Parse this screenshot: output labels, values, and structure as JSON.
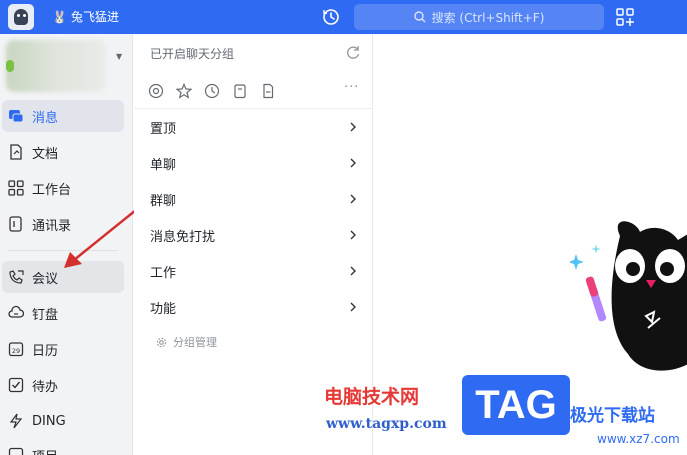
{
  "topbar": {
    "org_name": "兔飞猛进",
    "search_placeholder": "搜索 (Ctrl+Shift+F)"
  },
  "sidebar": {
    "items": [
      {
        "label": "消息",
        "icon": "message-icon",
        "active": true
      },
      {
        "label": "文档",
        "icon": "doc-icon"
      },
      {
        "label": "工作台",
        "icon": "grid-icon"
      },
      {
        "label": "通讯录",
        "icon": "contacts-icon"
      },
      {
        "label": "会议",
        "icon": "meeting-icon",
        "highlighted": true
      },
      {
        "label": "钉盘",
        "icon": "cloud-icon"
      },
      {
        "label": "日历",
        "icon": "calendar-icon"
      },
      {
        "label": "待办",
        "icon": "todo-icon"
      },
      {
        "label": "DING",
        "icon": "lightning-icon"
      },
      {
        "label": "项目",
        "icon": "project-icon"
      }
    ]
  },
  "middle": {
    "header": "已开启聊天分组",
    "groups": [
      "置顶",
      "单聊",
      "群聊",
      "消息免打扰",
      "工作",
      "功能"
    ],
    "manage_label": "分组管理"
  },
  "watermark": {
    "cn": "电脑技术网",
    "url": "www.tagxp.com",
    "tag": "TAG",
    "tag2": "极光下载站",
    "tag3": "www.xz7.com"
  },
  "colors": {
    "accent": "#2f6bf2",
    "arrow": "#d32f2f",
    "watermark_red": "#e53935"
  }
}
